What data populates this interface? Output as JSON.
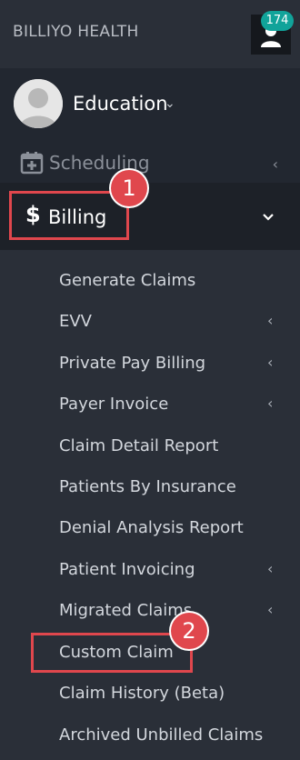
{
  "brand": "BILLIYO HEALTH",
  "notification_count": "174",
  "profile": {
    "org": "Education",
    "caret": "⌄"
  },
  "nav": {
    "scheduling": {
      "label": "Scheduling",
      "arrow": "‹"
    },
    "billing": {
      "label": "Billing",
      "symbol": "$"
    }
  },
  "markers": {
    "one": "1",
    "two": "2"
  },
  "submenu": [
    {
      "label": "Generate Claims",
      "arrow": ""
    },
    {
      "label": "EVV",
      "arrow": "‹"
    },
    {
      "label": "Private Pay Billing",
      "arrow": "‹"
    },
    {
      "label": "Payer Invoice",
      "arrow": "‹"
    },
    {
      "label": "Claim Detail Report",
      "arrow": ""
    },
    {
      "label": "Patients By Insurance",
      "arrow": ""
    },
    {
      "label": "Denial Analysis Report",
      "arrow": ""
    },
    {
      "label": "Patient Invoicing",
      "arrow": "‹"
    },
    {
      "label": "Migrated Claims",
      "arrow": "‹"
    },
    {
      "label": "Custom Claim",
      "arrow": ""
    },
    {
      "label": "Claim History (Beta)",
      "arrow": ""
    },
    {
      "label": "Archived Unbilled Claims",
      "arrow": ""
    }
  ],
  "colors": {
    "accent_badge": "#11a39a",
    "annotation": "#e0474d",
    "sidebar_bg": "#2a2f38"
  }
}
